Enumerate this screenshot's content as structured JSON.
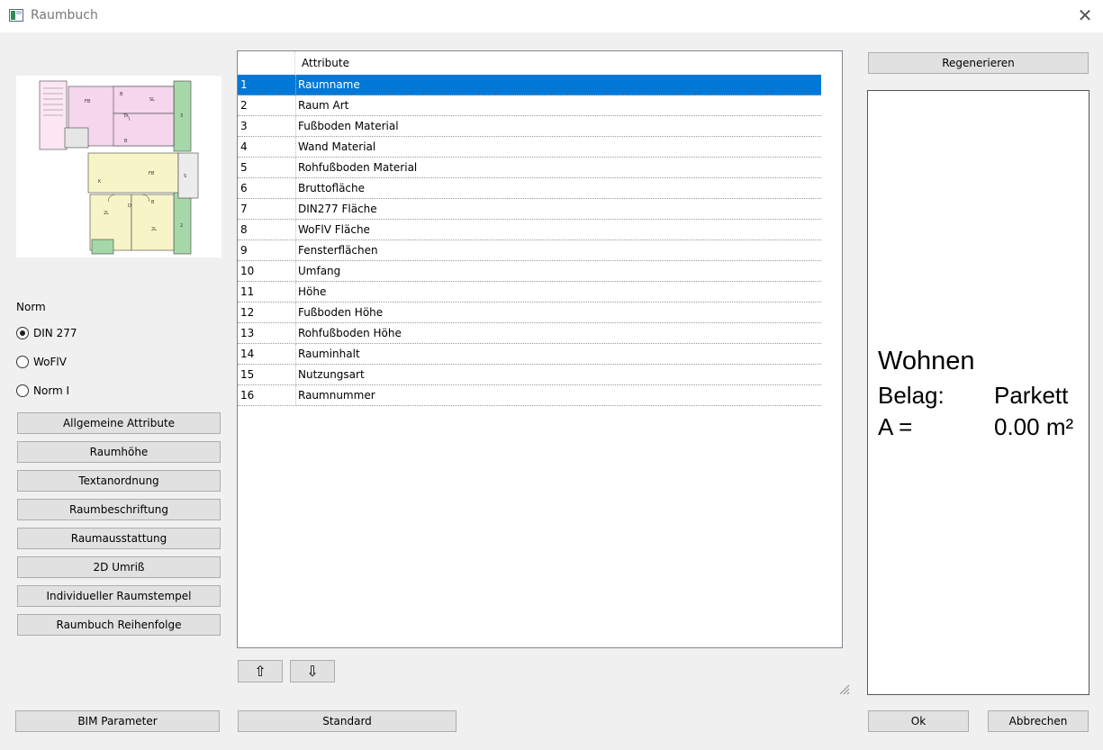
{
  "window": {
    "title": "Raumbuch",
    "close_glyph": "✕",
    "icon": "app-icon"
  },
  "norm": {
    "label": "Norm",
    "options": [
      {
        "label": "DIN 277",
        "checked": true
      },
      {
        "label": "WoFlV",
        "checked": false
      },
      {
        "label": "Norm I",
        "checked": false
      }
    ]
  },
  "left_buttons": [
    "Allgemeine Attribute",
    "Raumhöhe",
    "Textanordnung",
    "Raumbeschriftung",
    "Raumausstattung",
    "2D Umriß",
    "Individueller Raumstempel",
    "Raumbuch Reihenfolge"
  ],
  "table": {
    "header": "Attribute",
    "selected_index": 0,
    "rows": [
      {
        "idx": "1",
        "attr": "Raumname"
      },
      {
        "idx": "2",
        "attr": "Raum Art"
      },
      {
        "idx": "3",
        "attr": "Fußboden Material"
      },
      {
        "idx": "4",
        "attr": "Wand Material"
      },
      {
        "idx": "5",
        "attr": "Rohfußboden Material"
      },
      {
        "idx": "6",
        "attr": "Bruttofläche"
      },
      {
        "idx": "7",
        "attr": "DIN277 Fläche"
      },
      {
        "idx": "8",
        "attr": "WoFlV Fläche"
      },
      {
        "idx": "9",
        "attr": "Fensterflächen"
      },
      {
        "idx": "10",
        "attr": "Umfang"
      },
      {
        "idx": "11",
        "attr": "Höhe"
      },
      {
        "idx": "12",
        "attr": "Fußboden Höhe"
      },
      {
        "idx": "13",
        "attr": "Rohfußboden Höhe"
      },
      {
        "idx": "14",
        "attr": "Rauminhalt"
      },
      {
        "idx": "15",
        "attr": "Nutzungsart"
      },
      {
        "idx": "16",
        "attr": "Raumnummer"
      }
    ]
  },
  "move": {
    "up_glyph": "⇧",
    "down_glyph": "⇩"
  },
  "regen_label": "Regenerieren",
  "stamp": {
    "name": "Wohnen",
    "belag_label": "Belag:",
    "belag_value": "Parkett",
    "area_label": "A =",
    "area_value": "0.00 m²"
  },
  "footer": {
    "bim": "BIM Parameter",
    "standard": "Standard",
    "ok": "Ok",
    "cancel": "Abbrechen"
  },
  "floorplan": {
    "room_labels": [
      "FB",
      "B",
      "SL",
      "D",
      "B",
      "3",
      "S",
      "FB",
      "K",
      "D",
      "B",
      "2L",
      "2L",
      "2"
    ]
  },
  "colors": {
    "selection": "#0078d7",
    "pink_rooms": "#f6d6ec",
    "yellow_rooms": "#f7f5c8",
    "green_zone": "#a6d7a8"
  }
}
